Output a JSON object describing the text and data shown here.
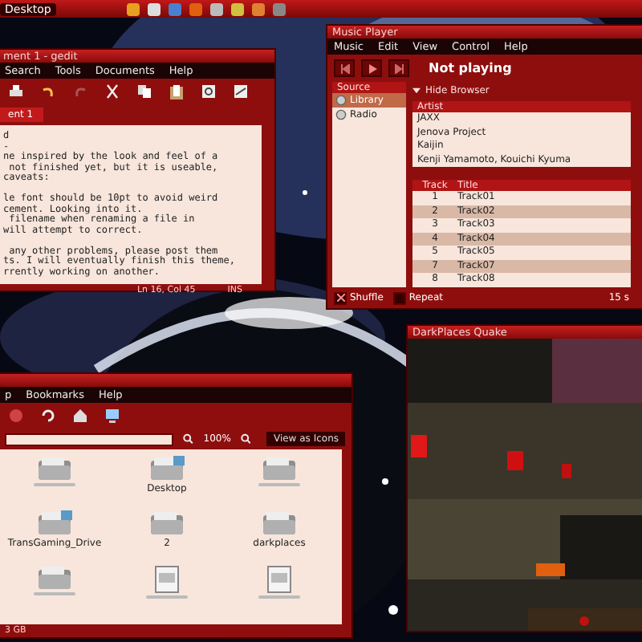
{
  "top_panel": {
    "label": "Desktop"
  },
  "editor": {
    "title": "ment 1 - gedit",
    "menu": [
      "Search",
      "Tools",
      "Documents",
      "Help"
    ],
    "tab": "ent 1",
    "paragraphs": [
      [
        "d",
        "-",
        "ne inspired by the look and feel of a",
        " not finished yet, but it is useable,",
        "caveats:"
      ],
      [
        "le font should be 10pt to avoid weird",
        "cement. Looking into it.",
        " filename when renaming a file in",
        "will attempt to correct."
      ],
      [
        " any other problems, please post them",
        "ts. I will eventually finish this theme,",
        "rrently working on another."
      ]
    ],
    "status": {
      "position": "Ln 16, Col 45",
      "mode": "INS"
    }
  },
  "music_player": {
    "title": "Music Player",
    "menu": [
      "Music",
      "Edit",
      "View",
      "Control",
      "Help"
    ],
    "now_playing": "Not playing",
    "source_header": "Source",
    "sources": [
      {
        "label": "Library",
        "selected": true
      },
      {
        "label": "Radio",
        "selected": false
      }
    ],
    "browser_toggle": "Hide Browser",
    "artist_header": "Artist",
    "artists": [
      "JAXX",
      "Jenova Project",
      "Kaijin",
      "Kenji Yamamoto, Kouichi Kyuma"
    ],
    "track_columns": [
      "Track",
      "Title"
    ],
    "tracks": [
      {
        "number": "1",
        "title": "Track01"
      },
      {
        "number": "2",
        "title": "Track02"
      },
      {
        "number": "3",
        "title": "Track03"
      },
      {
        "number": "4",
        "title": "Track04"
      },
      {
        "number": "5",
        "title": "Track05"
      },
      {
        "number": "7",
        "title": "Track07"
      },
      {
        "number": "8",
        "title": "Track08"
      }
    ],
    "shuffle": {
      "label": "Shuffle",
      "checked": true
    },
    "repeat": {
      "label": "Repeat",
      "checked": false
    },
    "status": "15 s"
  },
  "game_window": {
    "title": "DarkPlaces Quake"
  },
  "file_manager": {
    "menu": [
      "p",
      "Bookmarks",
      "Help"
    ],
    "zoom": "100%",
    "view_mode": "View as Icons",
    "items": [
      {
        "kind": "folder",
        "emblem": false
      },
      {
        "kind": "folder",
        "name": "Desktop",
        "emblem": true
      },
      {
        "kind": "folder",
        "emblem": false
      },
      {
        "kind": "folder",
        "name": "TransGaming_Drive",
        "emblem": true
      },
      {
        "kind": "folder",
        "name": "2",
        "emblem": false
      },
      {
        "kind": "folder",
        "name": "darkplaces",
        "emblem": false
      },
      {
        "kind": "folder",
        "emblem": false
      },
      {
        "kind": "document",
        "emblem": false
      },
      {
        "kind": "document",
        "emblem": false
      }
    ],
    "status": "3 GB"
  }
}
